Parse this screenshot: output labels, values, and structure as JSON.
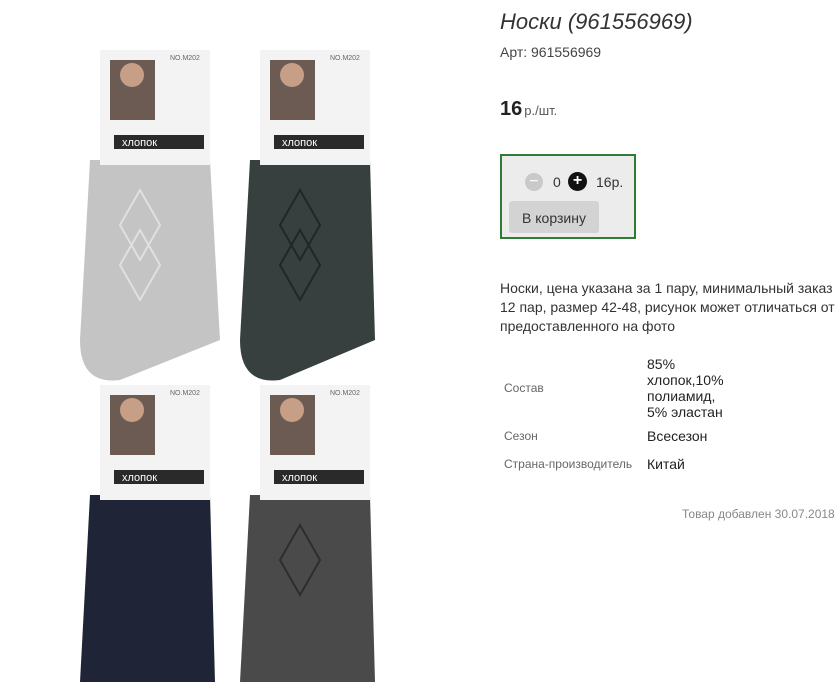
{
  "product": {
    "title": "Носки (961556969)",
    "sku": "Арт: 961556969",
    "price": "16",
    "price_unit": "р./шт.",
    "description": "Носки, цена указана за 1 пару, минимальный заказ 12 пар, размер 42-48, рисунок может отличаться от предоставленного на фото",
    "added": "Товар добавлен 30.07.2018"
  },
  "cart": {
    "minus": "−",
    "quantity": "0",
    "plus": "+",
    "sum": "16р.",
    "button": "В корзину"
  },
  "properties": [
    {
      "label": "Состав",
      "value": "85% хлопок,10% полиамид, 5% эластан"
    },
    {
      "label": "Сезон",
      "value": "Всесезон"
    },
    {
      "label": "Страна-производитель",
      "value": "Китай"
    }
  ],
  "gallery": {
    "socks": [
      {
        "color": "#c4c4c4",
        "label_code": "NO.M202",
        "label_text": "хлопок",
        "size_text": "Размер 42-48"
      },
      {
        "color": "#37403f",
        "label_code": "NO.M202",
        "label_text": "хлопок",
        "size_text": "Размер 42-48"
      },
      {
        "color": "#1f2537",
        "label_code": "NO.M202",
        "label_text": "хлопок",
        "size_text": "Размер 42-48"
      },
      {
        "color": "#4a4a4a",
        "label_code": "NO.M202",
        "label_text": "хлопок",
        "size_text": "Размер 42-48"
      }
    ]
  }
}
